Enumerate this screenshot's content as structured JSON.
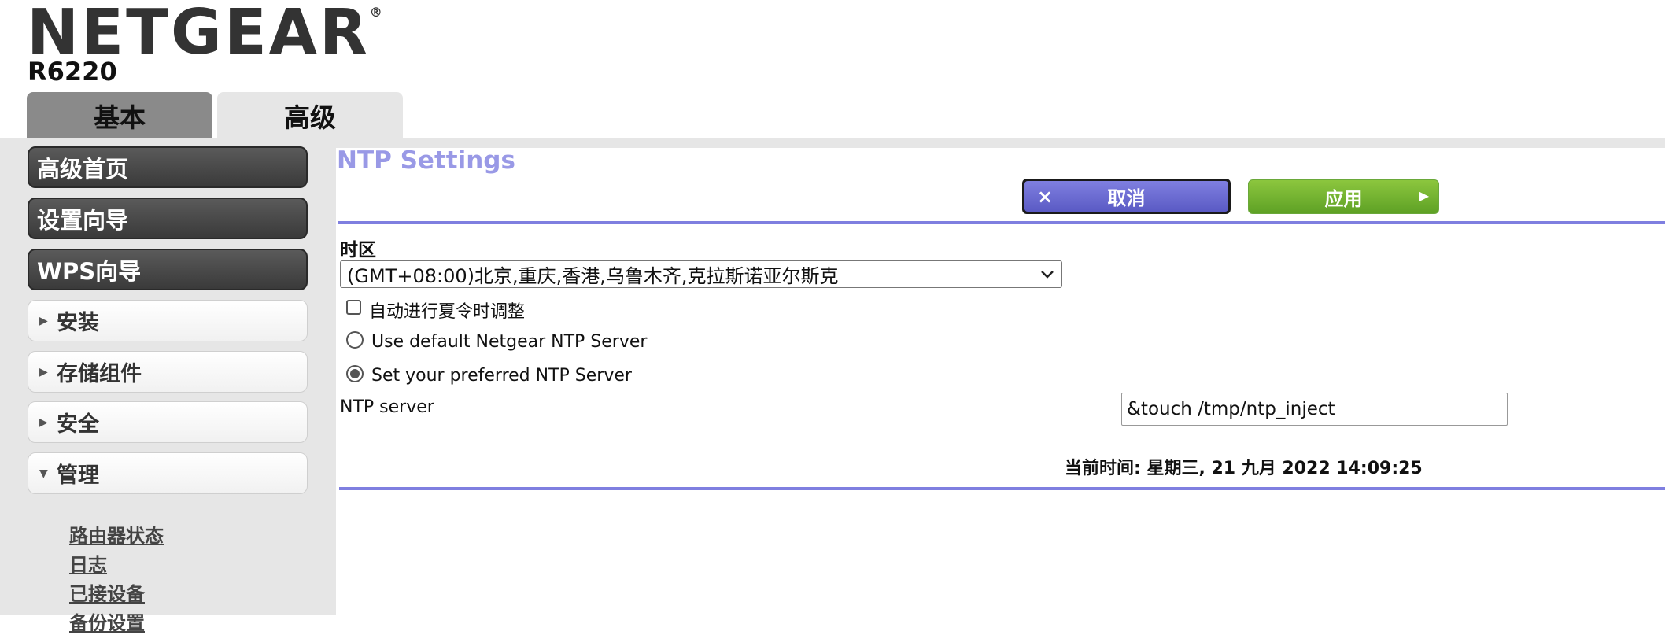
{
  "header": {
    "brand": "NETGEAR",
    "trademark": "®",
    "model": "R6220"
  },
  "tabs": [
    {
      "label": "基本",
      "active": false
    },
    {
      "label": "高级",
      "active": true
    }
  ],
  "sidebar": {
    "primary": [
      "高级首页",
      "设置向导",
      "WPS向导"
    ],
    "sections": [
      {
        "label": "安装",
        "expanded": false,
        "icon": "triangle-right-icon"
      },
      {
        "label": "存储组件",
        "expanded": false,
        "icon": "triangle-right-icon"
      },
      {
        "label": "安全",
        "expanded": false,
        "icon": "triangle-right-icon"
      },
      {
        "label": "管理",
        "expanded": true,
        "icon": "triangle-down-icon"
      }
    ],
    "sublinks": [
      "路由器状态",
      "日志",
      "已接设备",
      "备份设置"
    ]
  },
  "main": {
    "title": "NTP Settings",
    "cancel_label": "取消",
    "cancel_icon": "×",
    "apply_label": "应用",
    "apply_icon": "▶",
    "timezone_label": "时区",
    "timezone_value": "(GMT+08:00)北京,重庆,香港,乌鲁木齐,克拉斯诺亚尔斯克",
    "dst_label": "自动进行夏令时调整",
    "dst_checked": false,
    "radio_default_label": "Use default Netgear NTP Server",
    "radio_preferred_label": "Set your preferred NTP Server",
    "preferred_selected": true,
    "ntp_server_label": "NTP server",
    "ntp_server_value": "&touch /tmp/ntp_inject",
    "current_time": "当前时间: 星期三, 21 九月 2022 14:09:25"
  },
  "colors": {
    "accent_purple": "#7f7fe0",
    "title_purple": "#9999e6",
    "apply_green": "#6fb12f",
    "sidebar_bg": "#e6e6e6"
  }
}
